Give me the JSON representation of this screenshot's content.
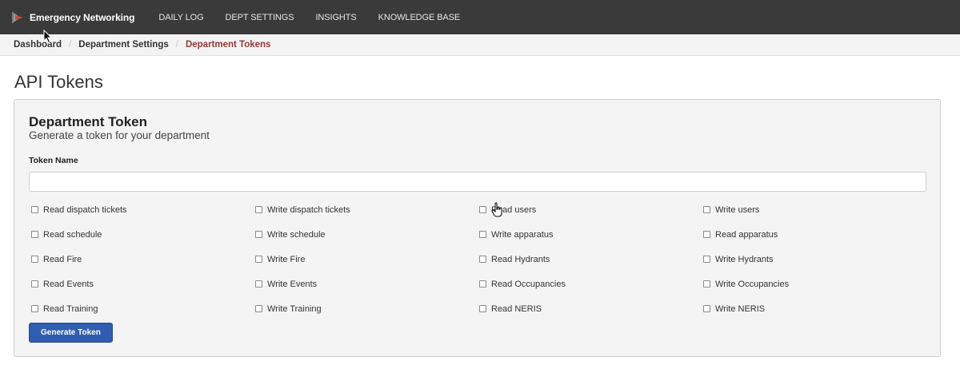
{
  "navbar": {
    "brand": "Emergency Networking",
    "links": [
      "DAILY LOG",
      "DEPT SETTINGS",
      "INSIGHTS",
      "KNOWLEDGE BASE"
    ]
  },
  "breadcrumb": [
    "Dashboard",
    "Department Settings",
    "Department Tokens"
  ],
  "page_title": "API Tokens",
  "card": {
    "title": "Department Token",
    "subtitle": "Generate a token for your department",
    "token_name_label": "Token Name",
    "token_name_value": "",
    "permissions": [
      [
        "Read dispatch tickets",
        "Write dispatch tickets",
        "Read users",
        "Write users"
      ],
      [
        "Read schedule",
        "Write schedule",
        "Write apparatus",
        "Read apparatus"
      ],
      [
        "Read Fire",
        "Write Fire",
        "Read Hydrants",
        "Write Hydrants"
      ],
      [
        "Read Events",
        "Write Events",
        "Read Occupancies",
        "Write Occupancies"
      ],
      [
        "Read Training",
        "Write Training",
        "Read NERIS",
        "Write NERIS"
      ]
    ],
    "generate_button": "Generate Token"
  },
  "colors": {
    "navbar_bg": "#3a3a3a",
    "active_crumb": "#8f3a3a",
    "primary_button": "#2f5db0"
  }
}
